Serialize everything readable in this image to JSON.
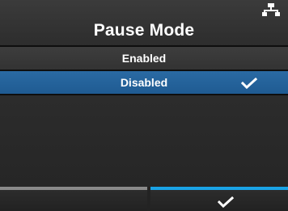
{
  "header": {
    "title": "Pause Mode",
    "status_icon": "network-icon"
  },
  "menu": {
    "items": [
      {
        "label": "Enabled",
        "selected": false
      },
      {
        "label": "Disabled",
        "selected": true
      }
    ]
  },
  "footer": {
    "back_button_icon": "none",
    "confirm_button_icon": "checkmark-icon"
  },
  "colors": {
    "selection_blue": "#2a6aa3",
    "accent_blue": "#1aa3e6",
    "inactive_bar_gray": "#8a8a8a"
  }
}
